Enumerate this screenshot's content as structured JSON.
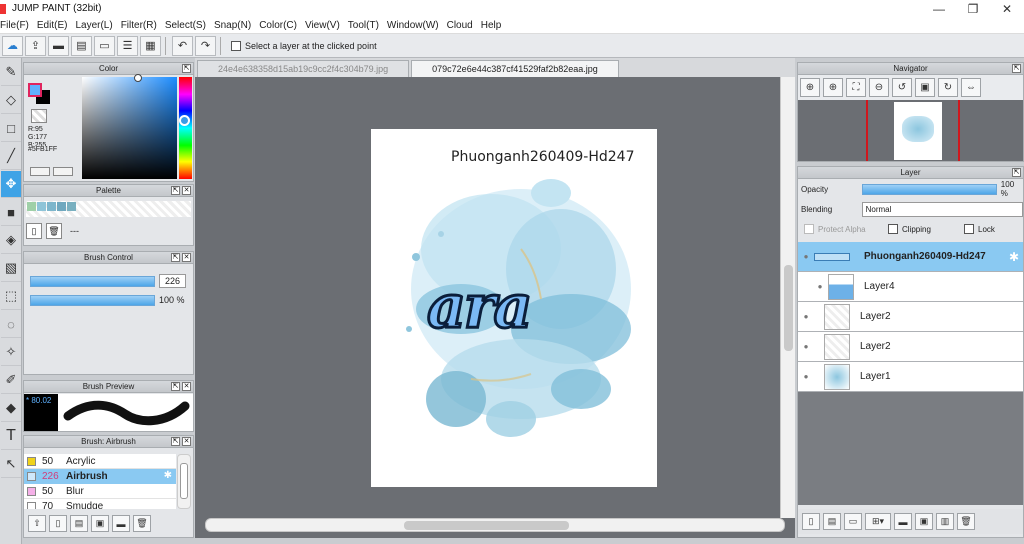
{
  "window": {
    "title": "JUMP PAINT (32bit)",
    "min": "—",
    "max": "❐",
    "close": "✕"
  },
  "menu": [
    "File(F)",
    "Edit(E)",
    "Layer(L)",
    "Filter(R)",
    "Select(S)",
    "Snap(N)",
    "Color(C)",
    "View(V)",
    "Tool(T)",
    "Window(W)",
    "Cloud",
    "Help"
  ],
  "toolbar": {
    "select_layer_label": "Select a layer at the clicked point"
  },
  "tabs": [
    {
      "label": "24e4e638358d15ab19c9cc2f4c304b79.jpg",
      "active": false
    },
    {
      "label": "079c72e6e44c387cf41529faf2b82eaa.jpg",
      "active": true
    }
  ],
  "canvas": {
    "text": "Phuonganh260409-Hd247",
    "lettering": "ara"
  },
  "color_panel": {
    "title": "Color",
    "r": "R:95",
    "g": "G:177",
    "b": "B:255",
    "hex": "#5FB1FF",
    "fg": "#5fb1ff",
    "bg": "#000000"
  },
  "palette_panel": {
    "title": "Palette",
    "name": "---",
    "swatches": [
      "#9fd0a8",
      "#8ec4d8",
      "#7db6cc",
      "#6fa8bf",
      "#79b0c0"
    ]
  },
  "brush_control": {
    "title": "Brush Control",
    "size": "226",
    "opacity": "100 %"
  },
  "brush_preview": {
    "title": "Brush Preview",
    "size_label": "* 80.02"
  },
  "brush_list": {
    "title": "Brush: Airbrush",
    "items": [
      {
        "size": "50",
        "name": "Acrylic",
        "color": "#f0d21a",
        "selected": false
      },
      {
        "size": "226",
        "name": "Airbrush",
        "color": "#cfe8fb",
        "selected": true
      },
      {
        "size": "50",
        "name": "Blur",
        "color": "#f5b0e8",
        "selected": false
      },
      {
        "size": "70",
        "name": "Smudge",
        "color": "#ffffff",
        "selected": false
      }
    ]
  },
  "navigator": {
    "title": "Navigator"
  },
  "layer_panel": {
    "title": "Layer",
    "opacity_label": "Opacity",
    "opacity_value": "100 %",
    "opacity_fraction": 1.0,
    "blending_label": "Blending",
    "blending_value": "Normal",
    "protect_alpha": "Protect Alpha",
    "clipping": "Clipping",
    "lock": "Lock",
    "layers": [
      {
        "name": "Phuonganh260409-Hd247",
        "selected": true,
        "folder": true
      },
      {
        "name": "Layer4",
        "selected": false
      },
      {
        "name": "Layer2",
        "selected": false
      },
      {
        "name": "Layer2",
        "selected": false
      },
      {
        "name": "Layer1",
        "selected": false
      }
    ]
  }
}
